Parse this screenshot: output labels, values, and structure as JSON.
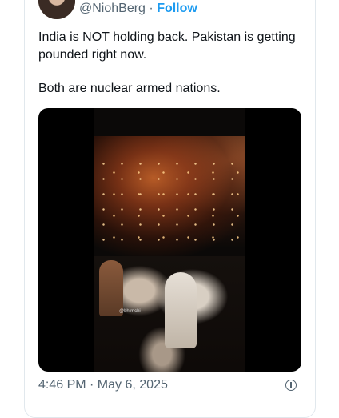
{
  "author": {
    "handle": "@NiohBerg",
    "separator": "·",
    "follow_label": "Follow"
  },
  "tweet": {
    "paragraphs": [
      "India is NOT holding back. Pakistan is getting pounded right now.",
      "Both are nuclear armed nations."
    ]
  },
  "media": {
    "type": "video",
    "watermark": "@bhimchi"
  },
  "footer": {
    "timestamp": "4:46 PM · May 6, 2025",
    "info_icon": "info-icon"
  }
}
